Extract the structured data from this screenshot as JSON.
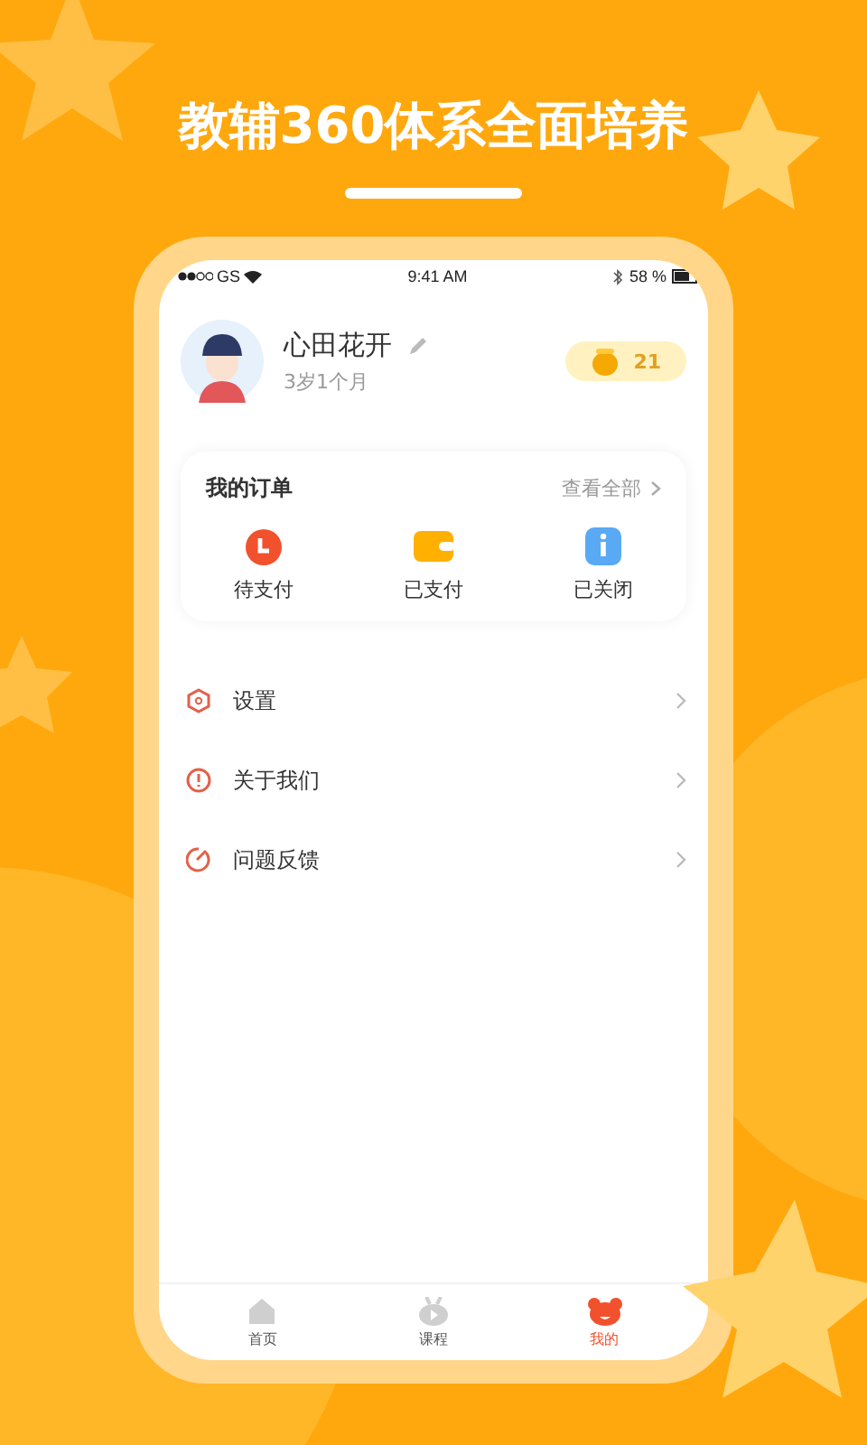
{
  "headline": "教辅360体系全面培养",
  "status_bar": {
    "carrier": "GS",
    "time": "9:41 AM",
    "battery": "58 %"
  },
  "profile": {
    "name": "心田花开",
    "age": "3岁1个月",
    "coins": "21"
  },
  "orders": {
    "title": "我的订单",
    "view_all": "查看全部",
    "items": [
      {
        "label": "待支付",
        "kind": "pending"
      },
      {
        "label": "已支付",
        "kind": "paid"
      },
      {
        "label": "已关闭",
        "kind": "closed"
      }
    ]
  },
  "menu": [
    {
      "label": "设置",
      "kind": "settings"
    },
    {
      "label": "关于我们",
      "kind": "about"
    },
    {
      "label": "问题反馈",
      "kind": "feedback"
    }
  ],
  "tabs": [
    {
      "label": "首页",
      "kind": "home",
      "selected": false
    },
    {
      "label": "课程",
      "kind": "course",
      "selected": false
    },
    {
      "label": "我的",
      "kind": "mine",
      "selected": true
    }
  ]
}
